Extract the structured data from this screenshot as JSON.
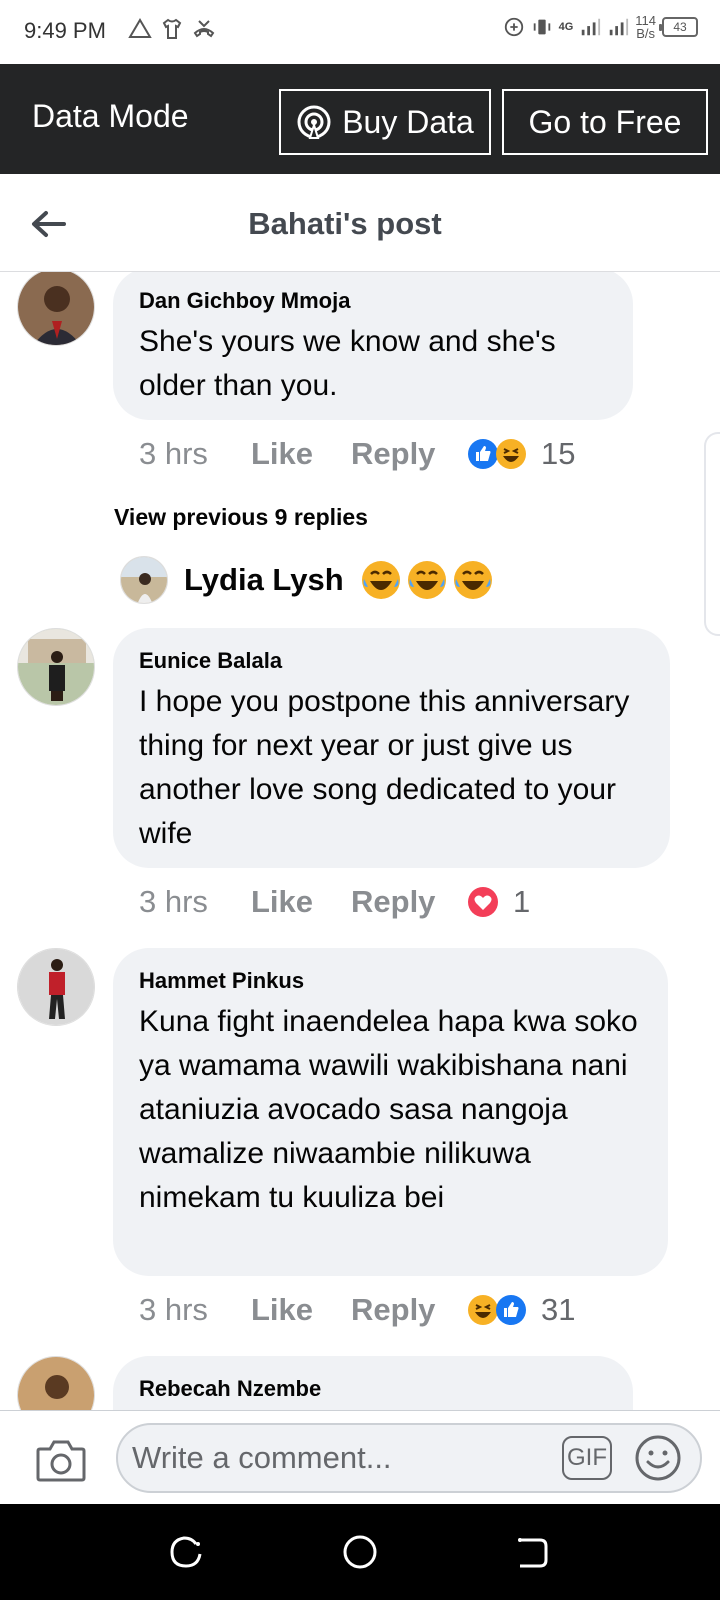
{
  "status_bar": {
    "time": "9:49 PM",
    "network_label": "4G",
    "speed_value": "114",
    "speed_unit": "B/s",
    "battery": "43"
  },
  "data_banner": {
    "mode_label": "Data Mode",
    "buy_data_label": "Buy Data",
    "go_free_label": "Go to Free"
  },
  "header": {
    "title": "Bahati's post"
  },
  "comments": [
    {
      "name": "Dan Gichboy Mmoja",
      "text": "She's yours we know and she's older than you.",
      "time": "3 hrs",
      "like_label": "Like",
      "reply_label": "Reply",
      "reactions": [
        "like-icon",
        "haha-icon"
      ],
      "reaction_count": "15"
    },
    {
      "name": "Eunice Balala",
      "text": "I hope you postpone this anniversary thing for next year  or just give us another love song dedicated to your wife",
      "time": "3 hrs",
      "like_label": "Like",
      "reply_label": "Reply",
      "reactions": [
        "love-icon"
      ],
      "reaction_count": "1"
    },
    {
      "name": "Hammet Pinkus",
      "text": "Kuna fight inaendelea hapa kwa soko ya wamama wawili wakibishana nani ataniuzia avocado  sasa nangoja wamalize niwaambie nilikuwa nimekam tu kuuliza bei",
      "time": "3 hrs",
      "like_label": "Like",
      "reply_label": "Reply",
      "reactions": [
        "haha-icon",
        "like-icon"
      ],
      "reaction_count": "31"
    }
  ],
  "view_previous": "View previous 9 replies",
  "reply_preview": {
    "name": "Lydia Lysh",
    "emoji": [
      "tears-of-joy-icon",
      "tears-of-joy-icon",
      "tears-of-joy-icon"
    ]
  },
  "next_comment_name": "Rebecah Nzembe",
  "composer": {
    "placeholder": "Write a comment...",
    "gif_label": "GIF"
  },
  "colors": {
    "banner_bg": "#242526",
    "bubble_bg": "#f0f2f5",
    "like_blue": "#1877f2",
    "love_red": "#f33e58",
    "meta_gray": "#8a8d91"
  }
}
